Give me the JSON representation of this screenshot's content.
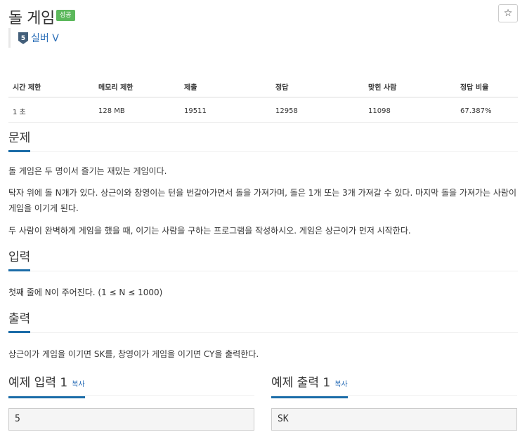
{
  "problem": {
    "title": "돌 게임",
    "status_badge": "성공",
    "star_glyph": "☆",
    "tier_number": "5",
    "tier_label": "실버 V"
  },
  "stats": {
    "headers": [
      "시간 제한",
      "메모리 제한",
      "제출",
      "정답",
      "맞힌 사람",
      "정답 비율"
    ],
    "values": [
      "1 초",
      "128 MB",
      "19511",
      "12958",
      "11098",
      "67.387%"
    ]
  },
  "sections": {
    "problem": {
      "heading": "문제",
      "paragraphs": [
        "돌 게임은 두 명이서 즐기는 재밌는 게임이다.",
        "탁자 위에 돌 N개가 있다. 상근이와 창영이는 턴을 번갈아가면서 돌을 가져가며, 돌은 1개 또는 3개 가져갈 수 있다. 마지막 돌을 가져가는 사람이 게임을 이기게 된다.",
        "두 사람이 완벽하게 게임을 했을 때, 이기는 사람을 구하는 프로그램을 작성하시오. 게임은 상근이가 먼저 시작한다."
      ]
    },
    "input": {
      "heading": "입력",
      "text": "첫째 줄에 N이 주어진다. (1 ≤ N ≤ 1000)"
    },
    "output": {
      "heading": "출력",
      "text": "상근이가 게임을 이기면 SK를, 창영이가 게임을 이기면 CY을 출력한다."
    }
  },
  "examples": {
    "input_title": "예제 입력 1",
    "output_title": "예제 출력 1",
    "copy_label": "복사",
    "input_value": "5",
    "output_value": "SK"
  },
  "colors": {
    "accent": "#1b6ca8",
    "link": "#2c6fb8",
    "success": "#5cb85c",
    "tier_silver": "#435f7a"
  }
}
